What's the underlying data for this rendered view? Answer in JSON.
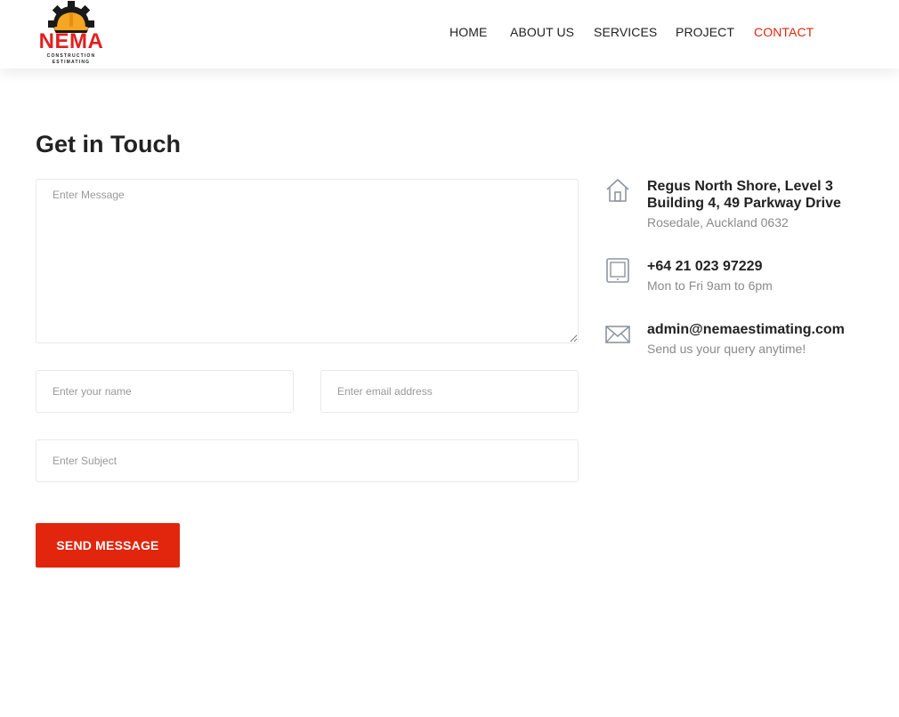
{
  "header": {
    "logo": {
      "name": "NEMA",
      "tagline_line1": "CONSTRUCTION",
      "tagline_line2": "ESTIMATING"
    },
    "nav": [
      {
        "label": "HOME",
        "active": false
      },
      {
        "label": "ABOUT US",
        "active": false
      },
      {
        "label": "SERVICES",
        "active": false
      },
      {
        "label": "PROJECT",
        "active": false
      },
      {
        "label": "CONTACT",
        "active": true
      }
    ]
  },
  "contact_form": {
    "title": "Get in Touch",
    "message": {
      "value": "",
      "placeholder": "Enter Message"
    },
    "name": {
      "value": "",
      "placeholder": "Enter your name"
    },
    "email": {
      "value": "",
      "placeholder": "Enter email address"
    },
    "subject": {
      "value": "",
      "placeholder": "Enter Subject"
    },
    "submit_label": "SEND MESSAGE"
  },
  "contact_info": [
    {
      "icon": "home-icon",
      "title_line1": "Regus North Shore, Level 3",
      "title_line2": "Building 4, 49 Parkway Drive",
      "subtitle": "Rosedale, Auckland 0632"
    },
    {
      "icon": "tablet-icon",
      "title_line1": "+64 21 023 97229",
      "subtitle": "Mon to Fri 9am to 6pm"
    },
    {
      "icon": "envelope-icon",
      "title_line1": "admin@nemaestimating.com",
      "subtitle": "Send us your query anytime!"
    }
  ],
  "colors": {
    "accent": "#e2250d",
    "text": "#222222",
    "muted": "#8a8a8a",
    "icon": "#8e95a0"
  }
}
